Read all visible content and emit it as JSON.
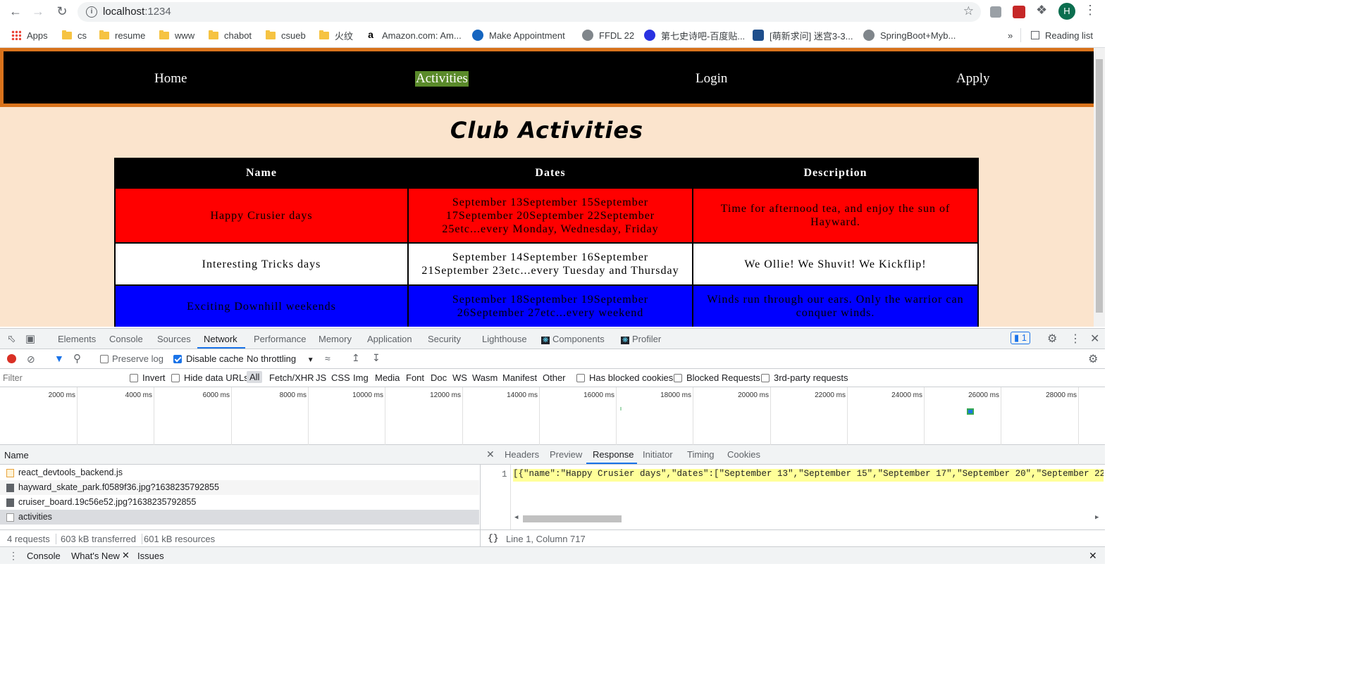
{
  "browser": {
    "url_host": "localhost",
    "url_port": ":1234",
    "avatar_letter": "H",
    "bookmarks": [
      "Apps",
      "cs",
      "resume",
      "www",
      "chabot",
      "csueb",
      "火纹",
      "Amazon.com: Am...",
      "Make Appointment",
      "FFDL 22",
      "第七史诗吧-百度贴...",
      "[萌新求问] 迷宫3-3...",
      "SpringBoot+Myb..."
    ],
    "bookmarks_more": "»",
    "reading_list": "Reading list"
  },
  "site": {
    "nav": [
      "Home",
      "Activities",
      "Login",
      "Apply"
    ],
    "active_nav": "Activities",
    "title": "Club Activities",
    "table": {
      "headers": [
        "Name",
        "Dates",
        "Description"
      ],
      "rows": [
        {
          "name": "Happy Crusier days",
          "dates": "September 13September 15September 17September 20September 22September 25etc...every Monday, Wednesday, Friday",
          "description": "Time for afternood tea, and enjoy the sun of Hayward."
        },
        {
          "name": "Interesting Tricks days",
          "dates": "September 14September 16September 21September 23etc...every Tuesday and Thursday",
          "description": "We Ollie! We Shuvit! We Kickflip!"
        },
        {
          "name": "Exciting Downhill weekends",
          "dates": "September 18September 19September 26September 27etc...every weekend",
          "description": "Winds run through our ears. Only the warrior can conquer winds."
        }
      ],
      "row_colors": [
        "#ff0000",
        "#ffffff",
        "#0000ff"
      ]
    }
  },
  "devtools": {
    "tabs": [
      "Elements",
      "Console",
      "Sources",
      "Network",
      "Performance",
      "Memory",
      "Application",
      "Security",
      "Lighthouse",
      "Components",
      "Profiler"
    ],
    "selected_tab": "Network",
    "issues_count": "1",
    "toolbar": {
      "preserve_log": "Preserve log",
      "disable_cache": "Disable cache",
      "throttling": "No throttling"
    },
    "filter": {
      "placeholder": "Filter",
      "invert": "Invert",
      "hide_data_urls": "Hide data URLs",
      "types": [
        "All",
        "Fetch/XHR",
        "JS",
        "CSS",
        "Img",
        "Media",
        "Font",
        "Doc",
        "WS",
        "Wasm",
        "Manifest",
        "Other"
      ],
      "has_blocked_cookies": "Has blocked cookies",
      "blocked_requests": "Blocked Requests",
      "third_party": "3rd-party requests"
    },
    "timeline_ticks": [
      "2000 ms",
      "4000 ms",
      "6000 ms",
      "8000 ms",
      "10000 ms",
      "12000 ms",
      "14000 ms",
      "16000 ms",
      "18000 ms",
      "20000 ms",
      "22000 ms",
      "24000 ms",
      "26000 ms",
      "28000 ms"
    ],
    "requests_header": "Name",
    "requests": [
      "react_devtools_backend.js",
      "hayward_skate_park.f0589f36.jpg?1638235792855",
      "cruiser_board.19c56e52.jpg?1638235792855",
      "activities"
    ],
    "summary": {
      "requests": "4 requests",
      "transferred": "603 kB transferred",
      "resources": "601 kB resources"
    },
    "response_tabs": [
      "Headers",
      "Preview",
      "Response",
      "Initiator",
      "Timing",
      "Cookies"
    ],
    "selected_response_tab": "Response",
    "line_number": "1",
    "response_text": "[{\"name\":\"Happy Crusier days\",\"dates\":[\"September 13\",\"September 15\",\"September 17\",\"September 20\",\"September 22\",\"September",
    "cursor_position": "Line 1, Column 717",
    "format_glyph": "{}",
    "drawer_tabs": [
      "Console",
      "What's New",
      "Issues"
    ]
  }
}
